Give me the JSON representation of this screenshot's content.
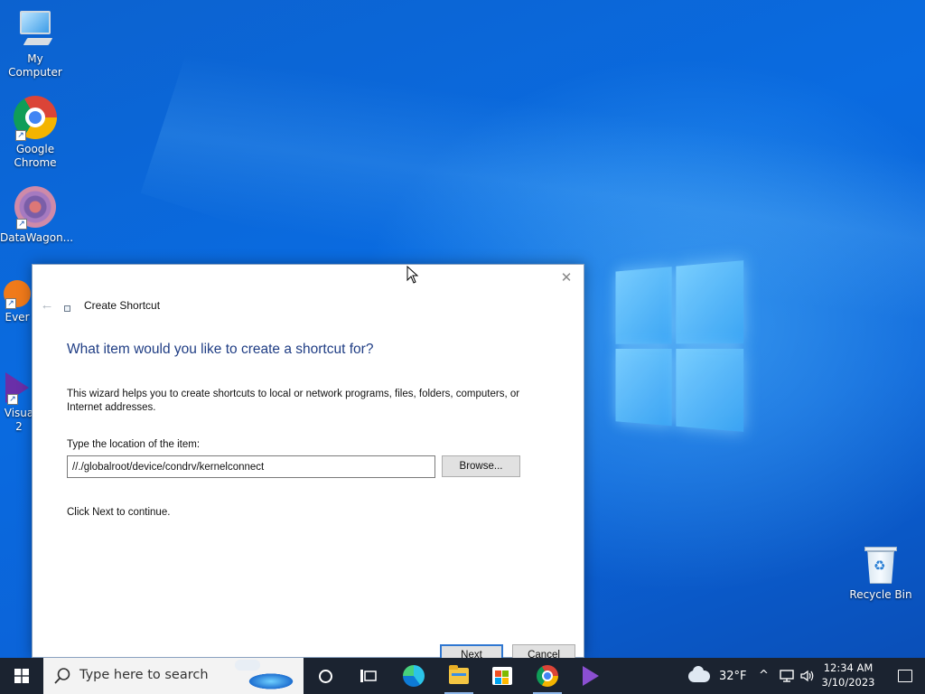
{
  "desktop": {
    "icons": [
      {
        "label": "My Computer",
        "icon": "computer-icon"
      },
      {
        "label": "Google\nChrome",
        "icon": "chrome-icon"
      },
      {
        "label": "DataWagon...",
        "icon": "datawagon-icon"
      },
      {
        "label": "Ever",
        "icon": "everything-icon"
      },
      {
        "label": "Visua\n2",
        "icon": "visual-studio-icon"
      },
      {
        "label": "Recycle Bin",
        "icon": "recycle-bin-icon"
      }
    ]
  },
  "dialog": {
    "title": "Create Shortcut",
    "heading": "What item would you like to create a shortcut for?",
    "description": "This wizard helps you to create shortcuts to local or network programs, files, folders, computers, or Internet addresses.",
    "location_label": "Type the location of the item:",
    "location_value": "//./globalroot/device/condrv/kernelconnect",
    "browse_label": "Browse...",
    "continue_text": "Click Next to continue.",
    "next_label": "Next",
    "cancel_label": "Cancel"
  },
  "taskbar": {
    "search_placeholder": "Type here to search",
    "apps": [
      "cortana-icon",
      "task-view-icon",
      "edge-icon",
      "file-explorer-icon",
      "microsoft-store-icon",
      "chrome-icon",
      "visual-studio-icon"
    ],
    "weather": "32°F",
    "time": "12:34 AM",
    "date": "3/10/2023"
  }
}
